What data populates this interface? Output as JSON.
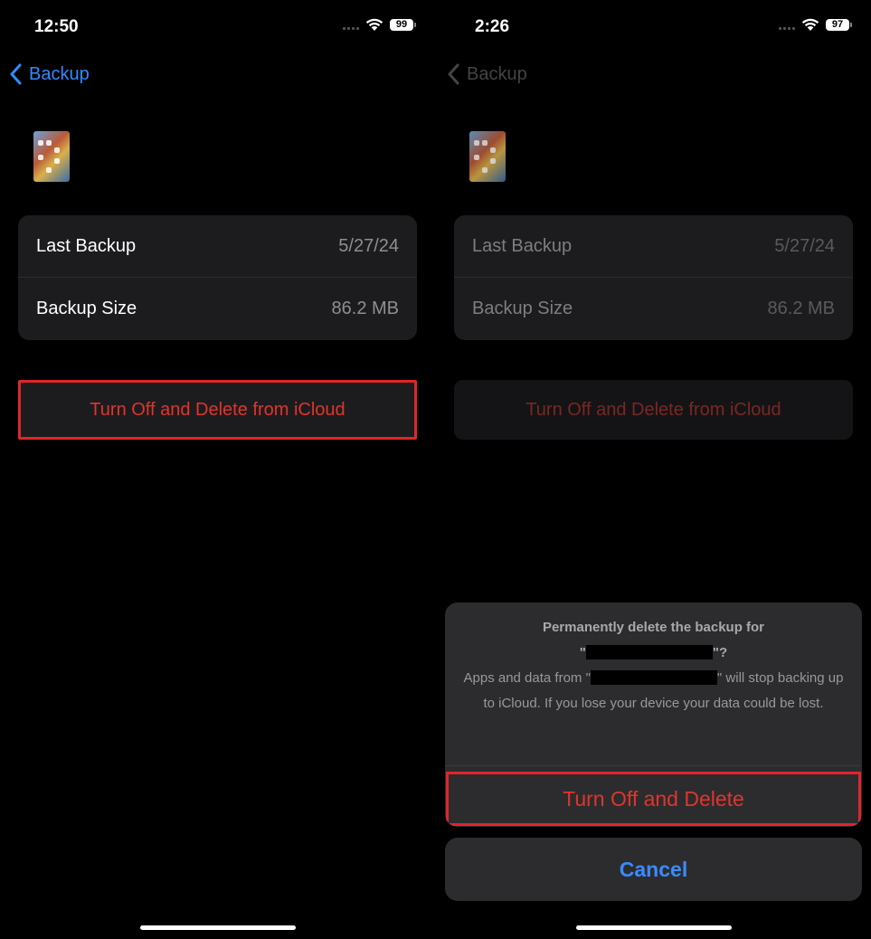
{
  "left_screen": {
    "status": {
      "time": "12:50",
      "battery": "99"
    },
    "nav": {
      "back_label": "Backup"
    },
    "info": {
      "last_backup_label": "Last Backup",
      "last_backup_value": "5/27/24",
      "backup_size_label": "Backup Size",
      "backup_size_value": "86.2 MB"
    },
    "delete_button": "Turn Off and Delete from iCloud"
  },
  "right_screen": {
    "status": {
      "time": "2:26",
      "battery": "97"
    },
    "nav": {
      "back_label": "Backup"
    },
    "info": {
      "last_backup_label": "Last Backup",
      "last_backup_value": "5/27/24",
      "backup_size_label": "Backup Size",
      "backup_size_value": "86.2 MB"
    },
    "delete_button": "Turn Off and Delete from iCloud",
    "action_sheet": {
      "title": "Permanently delete the backup for",
      "title_suffix": "\"?",
      "body_prefix": "Apps and data from \"",
      "body_suffix": "\" will stop backing up to iCloud. If you lose your device your data could be lost.",
      "confirm_label": "Turn Off and Delete",
      "cancel_label": "Cancel"
    }
  },
  "colors": {
    "accent_blue": "#2f8cff",
    "destructive_red": "#e0352b",
    "highlight_box": "#e1252a",
    "card_bg": "#1c1c1e",
    "sheet_bg": "#2c2c2e"
  }
}
